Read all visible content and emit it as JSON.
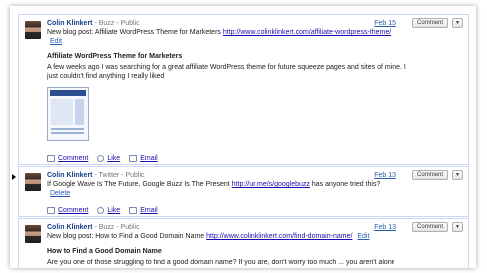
{
  "posts": [
    {
      "author": "Colin Klinkert",
      "meta": "- Buzz - Public",
      "date": "Feb 15",
      "comment_btn": "Comment",
      "text": "New blog post: Affiliate WordPress Theme for Marketers",
      "link": "http://www.colinklinkert.com/affiliate-wordpress-theme/",
      "edit": "Edit",
      "link_title": "Affiliate WordPress Theme for Marketers",
      "description": "A few weeks ago I was searching for a great affiliate WordPress theme for future squeeze pages and sites of mine. I just couldn't find anything I really liked",
      "actions": {
        "comment": "Comment",
        "like": "Like",
        "email": "Email"
      }
    },
    {
      "author": "Colin Klinkert",
      "meta": "- Twitter - Public",
      "date": "Feb 13",
      "comment_btn": "Comment",
      "text": "If Google Wave Is The Future, Google Buzz Is The Present",
      "link": "http://ur.me/s/googlebuzz",
      "text_after": "has anyone tried this?",
      "delete": "Delete",
      "actions": {
        "comment": "Comment",
        "like": "Like",
        "email": "Email"
      }
    },
    {
      "author": "Colin Klinkert",
      "meta": "- Buzz - Public",
      "date": "Feb 13",
      "comment_btn": "Comment",
      "text": "New blog post: How to Find a Good Domain Name",
      "link": "http://www.colinklinkert.com/find-domain-name/",
      "edit": "Edit",
      "link_title": "How to Find a Good Domain Name",
      "description": "Are you one of those struggling to find a good domain name? If you are, don't worry too much ... you aren't alone. I already had"
    }
  ],
  "dropdown_glyph": "▼"
}
